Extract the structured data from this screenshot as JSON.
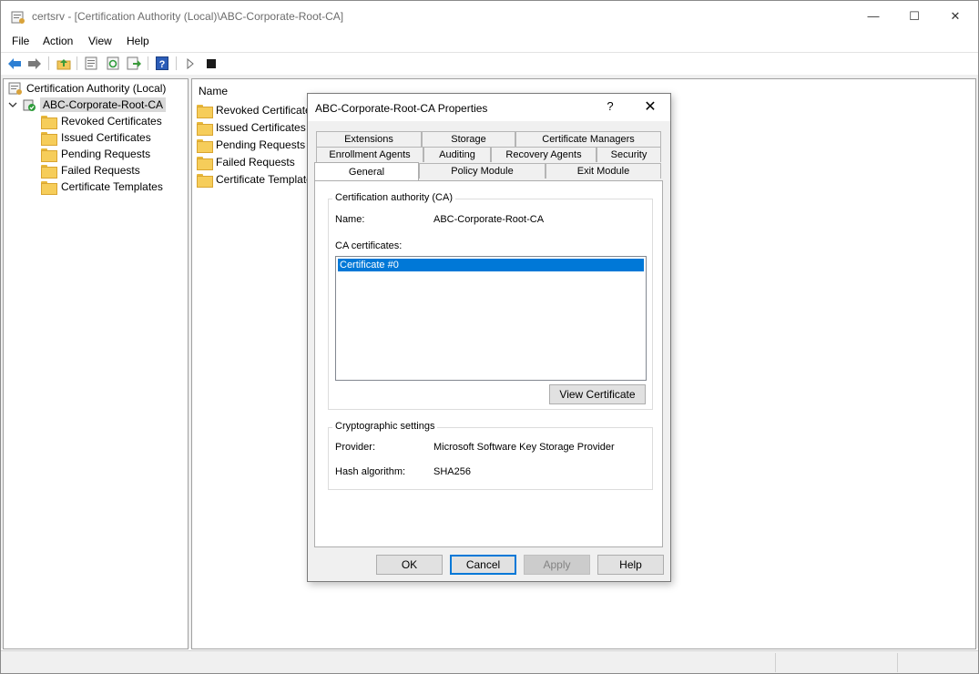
{
  "window": {
    "title": "certsrv - [Certification Authority (Local)\\ABC-Corporate-Root-CA]",
    "controls": {
      "minimize": "—",
      "maximize": "☐",
      "close": "✕"
    }
  },
  "menu": [
    "File",
    "Action",
    "View",
    "Help"
  ],
  "toolbar_icons": [
    "back-arrow-icon",
    "forward-arrow-icon",
    "up-folder-icon",
    "properties-icon",
    "refresh-icon",
    "export-list-icon",
    "help-icon",
    "start-service-icon",
    "stop-service-icon"
  ],
  "tree": {
    "root": "Certification Authority (Local)",
    "ca": "ABC-Corporate-Root-CA",
    "children": [
      "Revoked Certificates",
      "Issued Certificates",
      "Pending Requests",
      "Failed Requests",
      "Certificate Templates"
    ]
  },
  "list": {
    "column": "Name",
    "items": [
      "Revoked Certificates",
      "Issued Certificates",
      "Pending Requests",
      "Failed Requests",
      "Certificate Templates"
    ]
  },
  "dialog": {
    "title": "ABC-Corporate-Root-CA Properties",
    "help": "?",
    "close": "✕",
    "tabs_row1": [
      "Extensions",
      "Storage",
      "Certificate Managers"
    ],
    "tabs_row2": [
      "Enrollment Agents",
      "Auditing",
      "Recovery Agents",
      "Security"
    ],
    "tabs_row3": [
      "General",
      "Policy Module",
      "Exit Module"
    ],
    "ca_group": {
      "title": "Certification authority (CA)",
      "name_label": "Name:",
      "name_value": "ABC-Corporate-Root-CA",
      "certs_label": "CA certificates:",
      "certs": [
        "Certificate #0"
      ],
      "view_button": "View Certificate"
    },
    "crypto_group": {
      "title": "Cryptographic settings",
      "provider_label": "Provider:",
      "provider_value": "Microsoft Software Key Storage Provider",
      "hash_label": "Hash algorithm:",
      "hash_value": "SHA256"
    },
    "buttons": {
      "ok": "OK",
      "cancel": "Cancel",
      "apply": "Apply",
      "help": "Help"
    }
  }
}
